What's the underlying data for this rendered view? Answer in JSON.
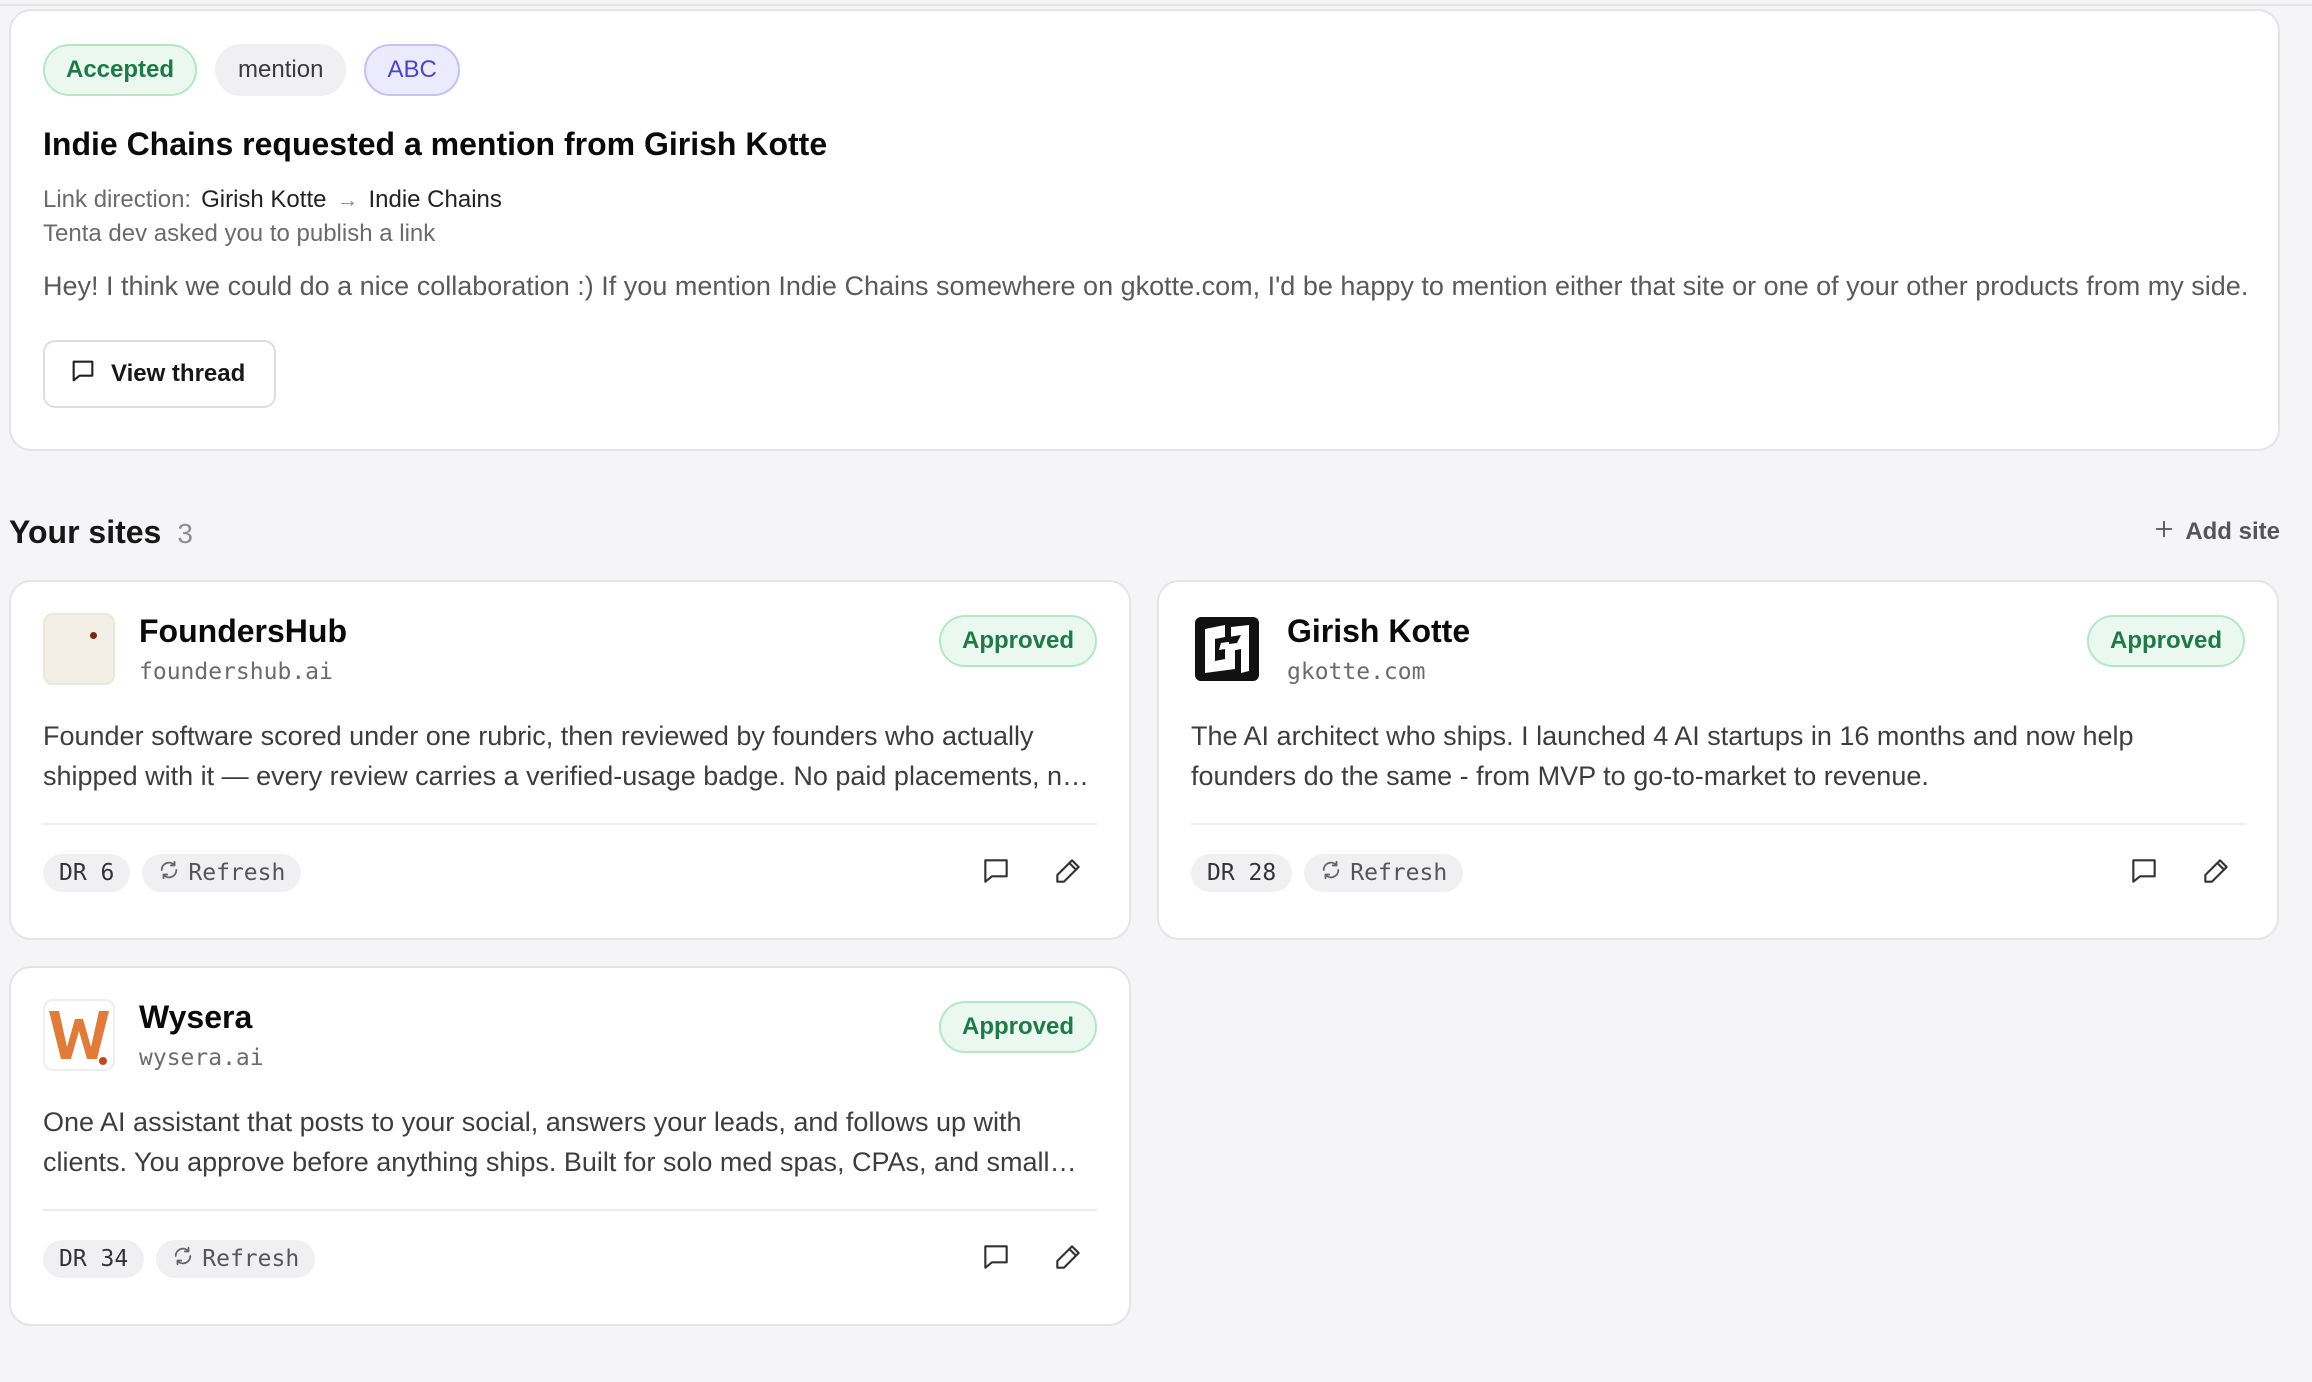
{
  "request": {
    "tags": {
      "status": "Accepted",
      "type": "mention",
      "label": "ABC"
    },
    "title": "Indie Chains requested a mention from Girish Kotte",
    "link_direction_label": "Link direction:",
    "from": "Girish Kotte",
    "to": "Indie Chains",
    "asked": "Tenta dev asked you to publish a link",
    "message": "Hey! I think we could do a nice collaboration :) If you mention Indie Chains somewhere on gkotte.com, I'd be happy to mention either that site or one of your other products from my side.",
    "view_thread_label": "View thread"
  },
  "sites_section": {
    "title": "Your sites",
    "count": "3",
    "add_site_label": "Add site"
  },
  "sites": [
    {
      "name": "FoundersHub",
      "domain": "foundershub.ai",
      "status": "Approved",
      "description": "Founder software scored under one rubric, then reviewed by founders who actually shipped with it — every review carries a verified-usage badge. No paid placements, no pay-to-play rankings.",
      "dr": "DR 6",
      "refresh_label": "Refresh",
      "logo_icon": "foundershub-logo"
    },
    {
      "name": "Girish Kotte",
      "domain": "gkotte.com",
      "status": "Approved",
      "description": "The AI architect who ships. I launched 4 AI startups in 16 months and now help founders do the same - from MVP to go-to-market to revenue.",
      "dr": "DR 28",
      "refresh_label": "Refresh",
      "logo_icon": "gk-monogram-logo"
    },
    {
      "name": "Wysera",
      "domain": "wysera.ai",
      "status": "Approved",
      "description": "One AI assistant that posts to your social, answers your leads, and follows up with clients. You approve before anything ships. Built for solo med spas, CPAs, and small teams.",
      "dr": "DR 34",
      "refresh_label": "Refresh",
      "logo_icon": "wysera-w-logo"
    }
  ],
  "colors": {
    "accepted_green": "#1e7a47",
    "abc_indigo": "#4b45c9",
    "page_bg": "#f5f5f7",
    "wysera_orange": "#e07b39"
  }
}
